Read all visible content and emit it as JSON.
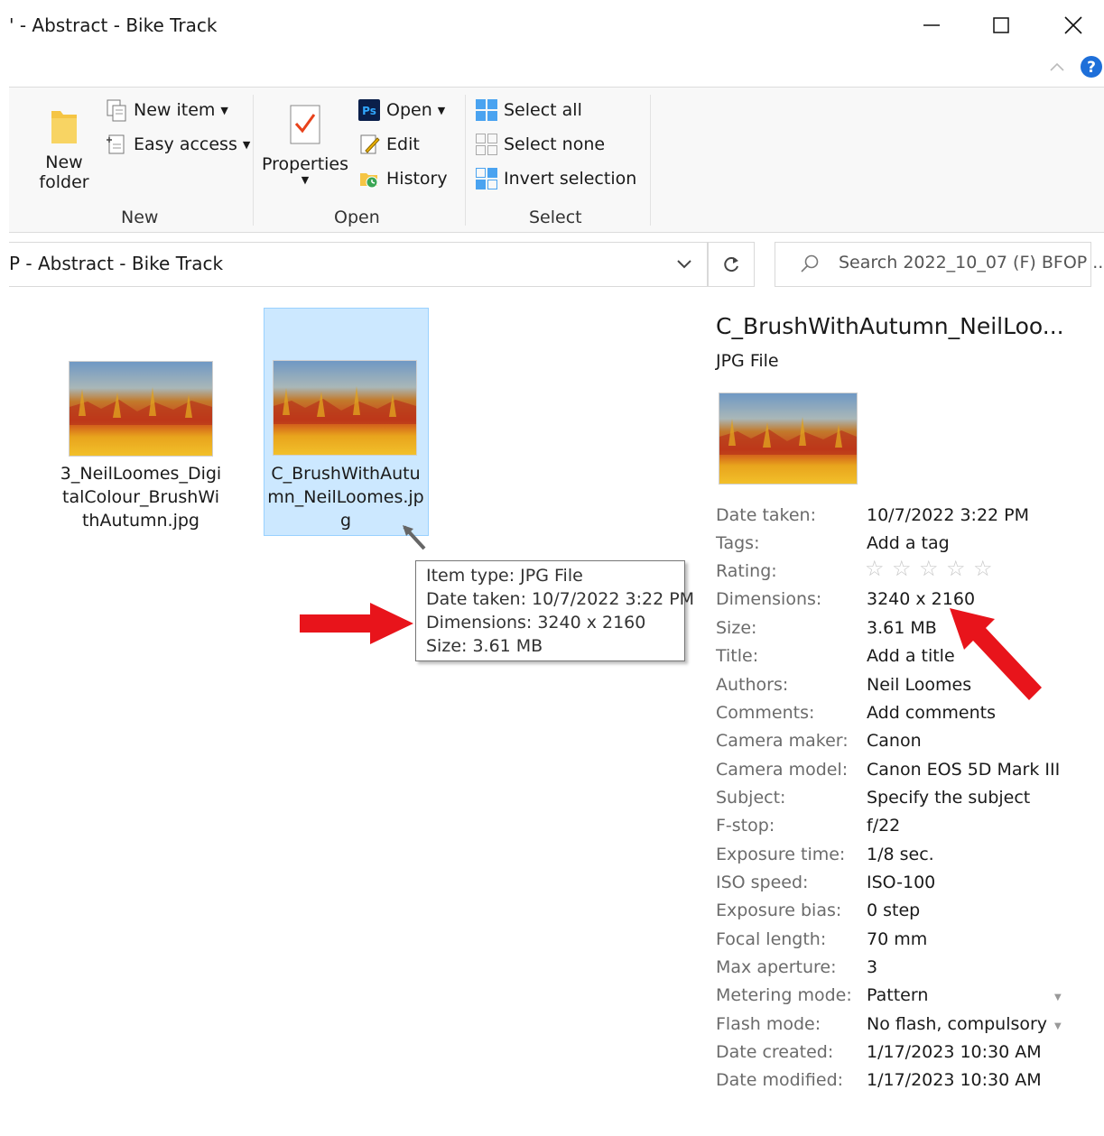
{
  "window": {
    "title": "' - Abstract - Bike Track"
  },
  "ribbon": {
    "new_group": {
      "label": "New",
      "new_folder_line1": "New",
      "new_folder_line2": "folder",
      "new_item": "New item",
      "easy_access": "Easy access"
    },
    "open_group": {
      "label": "Open",
      "properties": "Properties",
      "open": "Open",
      "edit": "Edit",
      "history": "History"
    },
    "select_group": {
      "label": "Select",
      "select_all": "Select all",
      "select_none": "Select none",
      "invert_selection": "Invert selection"
    }
  },
  "address": {
    "path": "P - Abstract - Bike Track",
    "search_placeholder": "Search 2022_10_07 (F) BFOP ..."
  },
  "files": [
    {
      "name": "3_NeilLoomes_DigitalColour_BrushWithAutumn.jpg"
    },
    {
      "name": "C_BrushWithAutumn_NeilLoomes.jpg"
    }
  ],
  "tooltip": {
    "item_type": "Item type: JPG File",
    "date_taken": "Date taken: 10/7/2022 3:22 PM",
    "dimensions": "Dimensions: 3240 x 2160",
    "size": "Size: 3.61 MB"
  },
  "details": {
    "title": "C_BrushWithAutumn_NeilLoo...",
    "type": "JPG File",
    "rating_stars": 0,
    "properties": [
      {
        "label": "Date taken:",
        "value": "10/7/2022 3:22 PM"
      },
      {
        "label": "Tags:",
        "value": "Add a tag"
      },
      {
        "label": "Rating:",
        "value": ""
      },
      {
        "label": "Dimensions:",
        "value": "3240 x 2160"
      },
      {
        "label": "Size:",
        "value": "3.61 MB"
      },
      {
        "label": "Title:",
        "value": "Add a title"
      },
      {
        "label": "Authors:",
        "value": "Neil Loomes"
      },
      {
        "label": "Comments:",
        "value": "Add comments"
      },
      {
        "label": "Camera maker:",
        "value": "Canon"
      },
      {
        "label": "Camera model:",
        "value": "Canon EOS 5D Mark III"
      },
      {
        "label": "Subject:",
        "value": "Specify the subject"
      },
      {
        "label": "F-stop:",
        "value": "f/22"
      },
      {
        "label": "Exposure time:",
        "value": "1/8 sec."
      },
      {
        "label": "ISO speed:",
        "value": "ISO-100"
      },
      {
        "label": "Exposure bias:",
        "value": "0 step"
      },
      {
        "label": "Focal length:",
        "value": "70 mm"
      },
      {
        "label": "Max aperture:",
        "value": "3"
      },
      {
        "label": "Metering mode:",
        "value": "Pattern"
      },
      {
        "label": "Flash mode:",
        "value": "No flash, compulsory"
      },
      {
        "label": "Date created:",
        "value": "1/17/2023 10:30 AM"
      },
      {
        "label": "Date modified:",
        "value": "1/17/2023 10:30 AM"
      }
    ]
  },
  "colors": {
    "selection": "#cce8ff",
    "accent": "#0078d7",
    "annotation_arrow": "#e8141b"
  }
}
